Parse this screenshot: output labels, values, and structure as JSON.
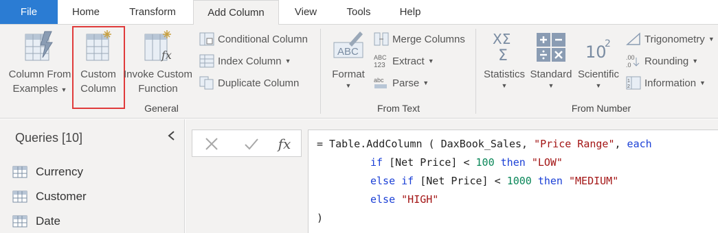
{
  "tabs": [
    {
      "label": "File"
    },
    {
      "label": "Home"
    },
    {
      "label": "Transform"
    },
    {
      "label": "Add Column",
      "active": true
    },
    {
      "label": "View"
    },
    {
      "label": "Tools"
    },
    {
      "label": "Help"
    }
  ],
  "ribbon": {
    "general": {
      "label": "General",
      "column_from_examples": {
        "line1": "Column From",
        "line2": "Examples"
      },
      "custom_column": {
        "line1": "Custom",
        "line2": "Column"
      },
      "invoke_custom_function": {
        "line1": "Invoke Custom",
        "line2": "Function"
      },
      "conditional_column": "Conditional Column",
      "index_column": "Index Column",
      "duplicate_column": "Duplicate Column"
    },
    "from_text": {
      "label": "From Text",
      "format": "Format",
      "merge_columns": "Merge Columns",
      "extract": "Extract",
      "parse": "Parse"
    },
    "from_number": {
      "label": "From Number",
      "statistics": "Statistics",
      "standard": "Standard",
      "scientific": "Scientific",
      "trigonometry": "Trigonometry",
      "rounding": "Rounding",
      "information": "Information"
    }
  },
  "queries": {
    "title": "Queries [10]",
    "items": [
      "Currency",
      "Customer",
      "Date"
    ]
  },
  "formula_bar": {
    "fx": "fx",
    "line1": {
      "a": "= Table.AddColumn ( DaxBook_Sales, ",
      "b": "\"Price Range\"",
      "c": ", ",
      "d": "each"
    },
    "line2": {
      "a": "if",
      "b": " [Net Price] < ",
      "c": "100",
      "d": " ",
      "e": "then",
      "f": " ",
      "g": "\"LOW\""
    },
    "line3": {
      "a": "else if",
      "b": " [Net Price] < ",
      "c": "1000",
      "d": " ",
      "e": "then",
      "f": " ",
      "g": "\"MEDIUM\""
    },
    "line4": {
      "a": "else",
      "b": " ",
      "c": "\"HIGH\""
    },
    "line5": ")"
  },
  "colors": {
    "file_tab": "#2b7cd3",
    "highlight": "#e03a3a",
    "keyword": "#1a3fd6",
    "string": "#a31515",
    "number": "#098658"
  }
}
